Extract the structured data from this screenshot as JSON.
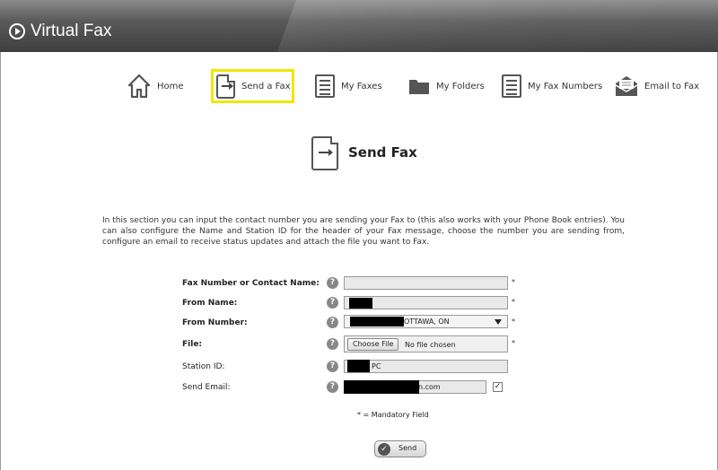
{
  "app": {
    "title": "Virtual Fax"
  },
  "nav": {
    "home": "Home",
    "send_fax": "Send a Fax",
    "my_faxes": "My Faxes",
    "my_folders": "My Folders",
    "my_fax_numbers": "My Fax Numbers",
    "email_to_fax": "Email to Fax"
  },
  "page": {
    "heading": "Send Fax",
    "description": "In this section you can input the contact number you are sending your Fax to (this also works with your Phone Book entries). You can also configure the Name and Station ID for the header of your Fax message, choose the number you are sending from, configure an email to receive status updates and attach the file you want to Fax."
  },
  "form": {
    "fax_number_label": "Fax Number or Contact Name:",
    "fax_number_value": "",
    "from_name_label": "From Name:",
    "from_number_label": "From Number:",
    "from_number_value": "OTTAWA, ON",
    "file_label": "File:",
    "choose_file_button": "Choose File",
    "no_file_text": "No file chosen",
    "station_id_label": "Station ID:",
    "station_id_value": "PC",
    "send_email_label": "Send Email:",
    "send_email_value": "n.com",
    "send_email_checked": true,
    "required_mark": "*",
    "help_glyph": "?",
    "mandatory_note": "* = Mandatory Field",
    "send_button": "Send"
  },
  "colors": {
    "highlight": "#f2e600",
    "header_dark": "#3f3f3f"
  }
}
